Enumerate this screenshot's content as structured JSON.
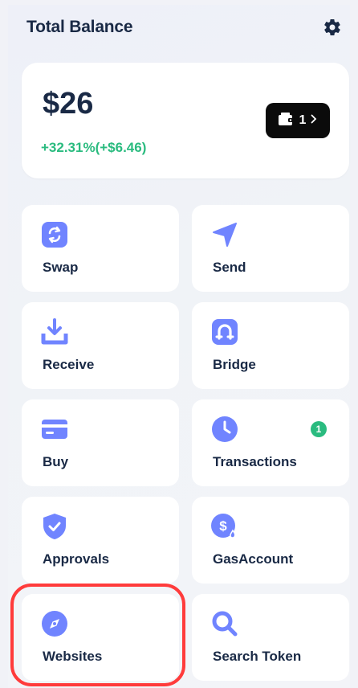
{
  "header": {
    "title": "Total Balance",
    "settings_icon": "gear-icon"
  },
  "balance": {
    "amount": "$26",
    "change": "+32.31%(+$6.46)",
    "wallet_count": "1",
    "wallet_icon": "wallet-icon",
    "chevron_icon": "chevron-right-icon"
  },
  "actions": [
    {
      "label": "Swap",
      "icon": "swap-icon"
    },
    {
      "label": "Send",
      "icon": "send-icon"
    },
    {
      "label": "Receive",
      "icon": "receive-icon"
    },
    {
      "label": "Bridge",
      "icon": "bridge-icon"
    },
    {
      "label": "Buy",
      "icon": "card-icon"
    },
    {
      "label": "Transactions",
      "icon": "clock-icon",
      "badge": "1"
    },
    {
      "label": "Approvals",
      "icon": "shield-check-icon"
    },
    {
      "label": "GasAccount",
      "icon": "gas-dollar-icon"
    },
    {
      "label": "Websites",
      "icon": "compass-icon"
    },
    {
      "label": "Search Token",
      "icon": "search-icon"
    }
  ],
  "colors": {
    "accent": "#7084ff",
    "positive": "#2abb7f",
    "highlight": "#ff3b3b",
    "text": "#192945"
  }
}
